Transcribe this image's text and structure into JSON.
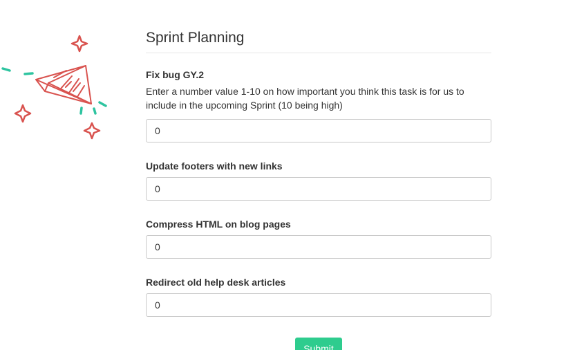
{
  "page": {
    "title": "Sprint Planning"
  },
  "illustration": {
    "icon": "paper-plane-icon",
    "colors": {
      "plane": "#d9534f",
      "sparkle": "#d9534f",
      "dash": "#2ec4a0"
    }
  },
  "form": {
    "fields": [
      {
        "label": "Fix bug GY.2",
        "help": "Enter a number value 1-10 on how important you think this task is for us to include in the upcoming Sprint (10 being high)",
        "value": "0"
      },
      {
        "label": "Update footers with new links",
        "value": "0"
      },
      {
        "label": "Compress HTML on blog pages",
        "value": "0"
      },
      {
        "label": "Redirect old help desk articles",
        "value": "0"
      }
    ],
    "submit_label": "Submit",
    "submit_color": "#2ecc8e"
  }
}
